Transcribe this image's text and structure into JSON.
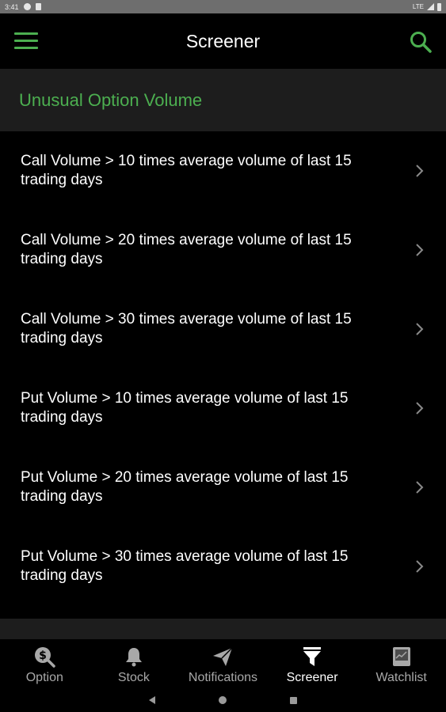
{
  "status_bar": {
    "time": "3:41",
    "network": "LTE"
  },
  "app_bar": {
    "title": "Screener"
  },
  "section": {
    "title": "Unusual Option Volume"
  },
  "screeners": [
    {
      "label": "Call Volume > 10 times average volume of last 15 trading days"
    },
    {
      "label": "Call Volume > 20 times average volume of last 15 trading days"
    },
    {
      "label": "Call Volume > 30 times average volume of last 15 trading days"
    },
    {
      "label": "Put Volume > 10 times average volume of last 15 trading days"
    },
    {
      "label": "Put Volume > 20 times average volume of last 15 trading days"
    },
    {
      "label": "Put Volume > 30 times average volume of last 15 trading days"
    }
  ],
  "bottom_nav": [
    {
      "label": "Option",
      "icon": "dollar-coin-icon",
      "active": false
    },
    {
      "label": "Stock",
      "icon": "bell-icon",
      "active": false
    },
    {
      "label": "Notifications",
      "icon": "paper-plane-icon",
      "active": false
    },
    {
      "label": "Screener",
      "icon": "funnel-icon",
      "active": true
    },
    {
      "label": "Watchlist",
      "icon": "chart-book-icon",
      "active": false
    }
  ],
  "colors": {
    "accent": "#4caf50",
    "background": "#000000",
    "section_bg": "#1d1d1d",
    "inactive": "#a8a8a8"
  }
}
